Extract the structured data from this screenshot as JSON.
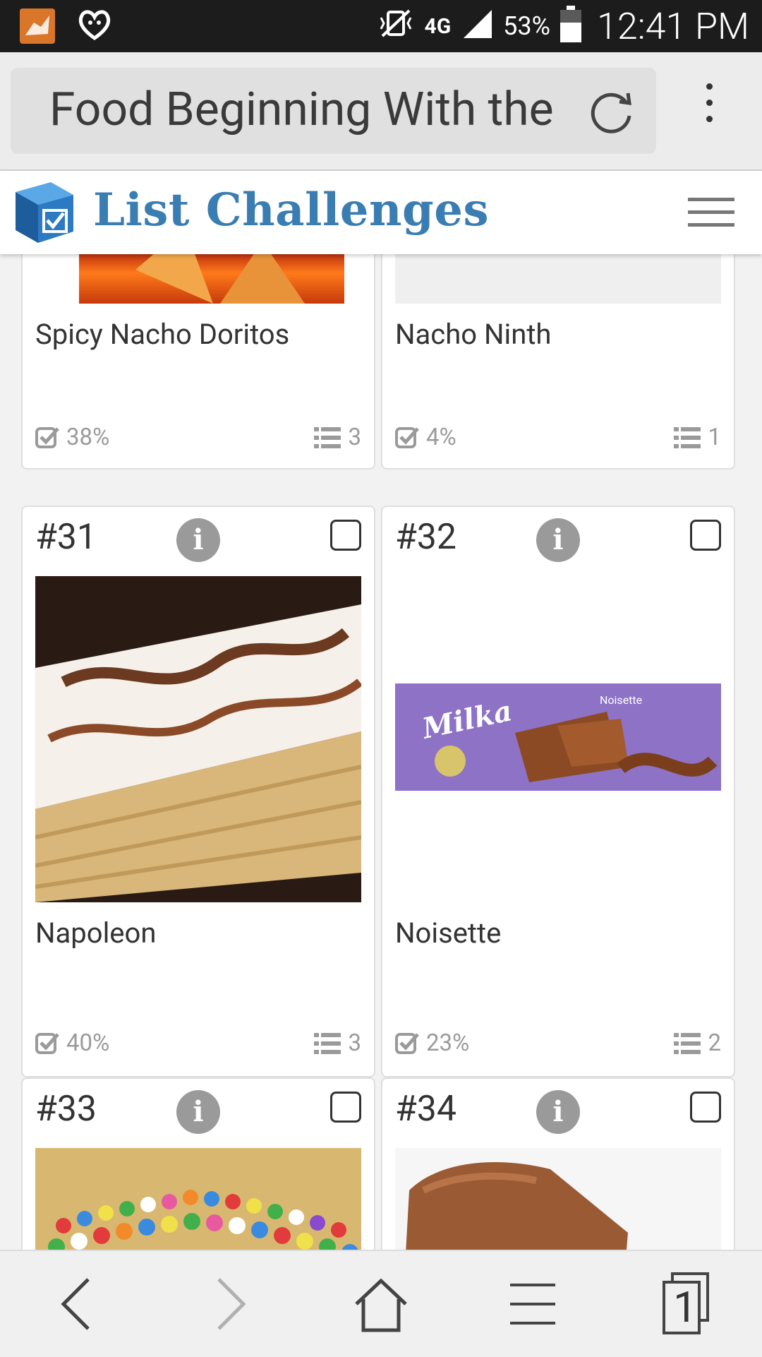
{
  "status_bar": {
    "battery": "53%",
    "time": "12:41 PM",
    "network": "4G"
  },
  "browser": {
    "url_text": "Food Beginning With the"
  },
  "site": {
    "brand": "List Challenges"
  },
  "items": [
    {
      "name": "Spicy Nacho Doritos",
      "percent": "38%",
      "lists": "3"
    },
    {
      "name": "Nacho Ninth",
      "percent": "4%",
      "lists": "1"
    },
    {
      "number": "#31",
      "name": "Napoleon",
      "percent": "40%",
      "lists": "3"
    },
    {
      "number": "#32",
      "name": "Noisette",
      "percent": "23%",
      "lists": "2",
      "image_text": {
        "brand": "Milka",
        "variant": "Noisette"
      }
    },
    {
      "number": "#33"
    },
    {
      "number": "#34"
    }
  ],
  "bottom_nav": {
    "tabs_count": "1"
  },
  "colors": {
    "brand_blue": "#3a7db3",
    "status_bar": "#1c1c1c"
  }
}
